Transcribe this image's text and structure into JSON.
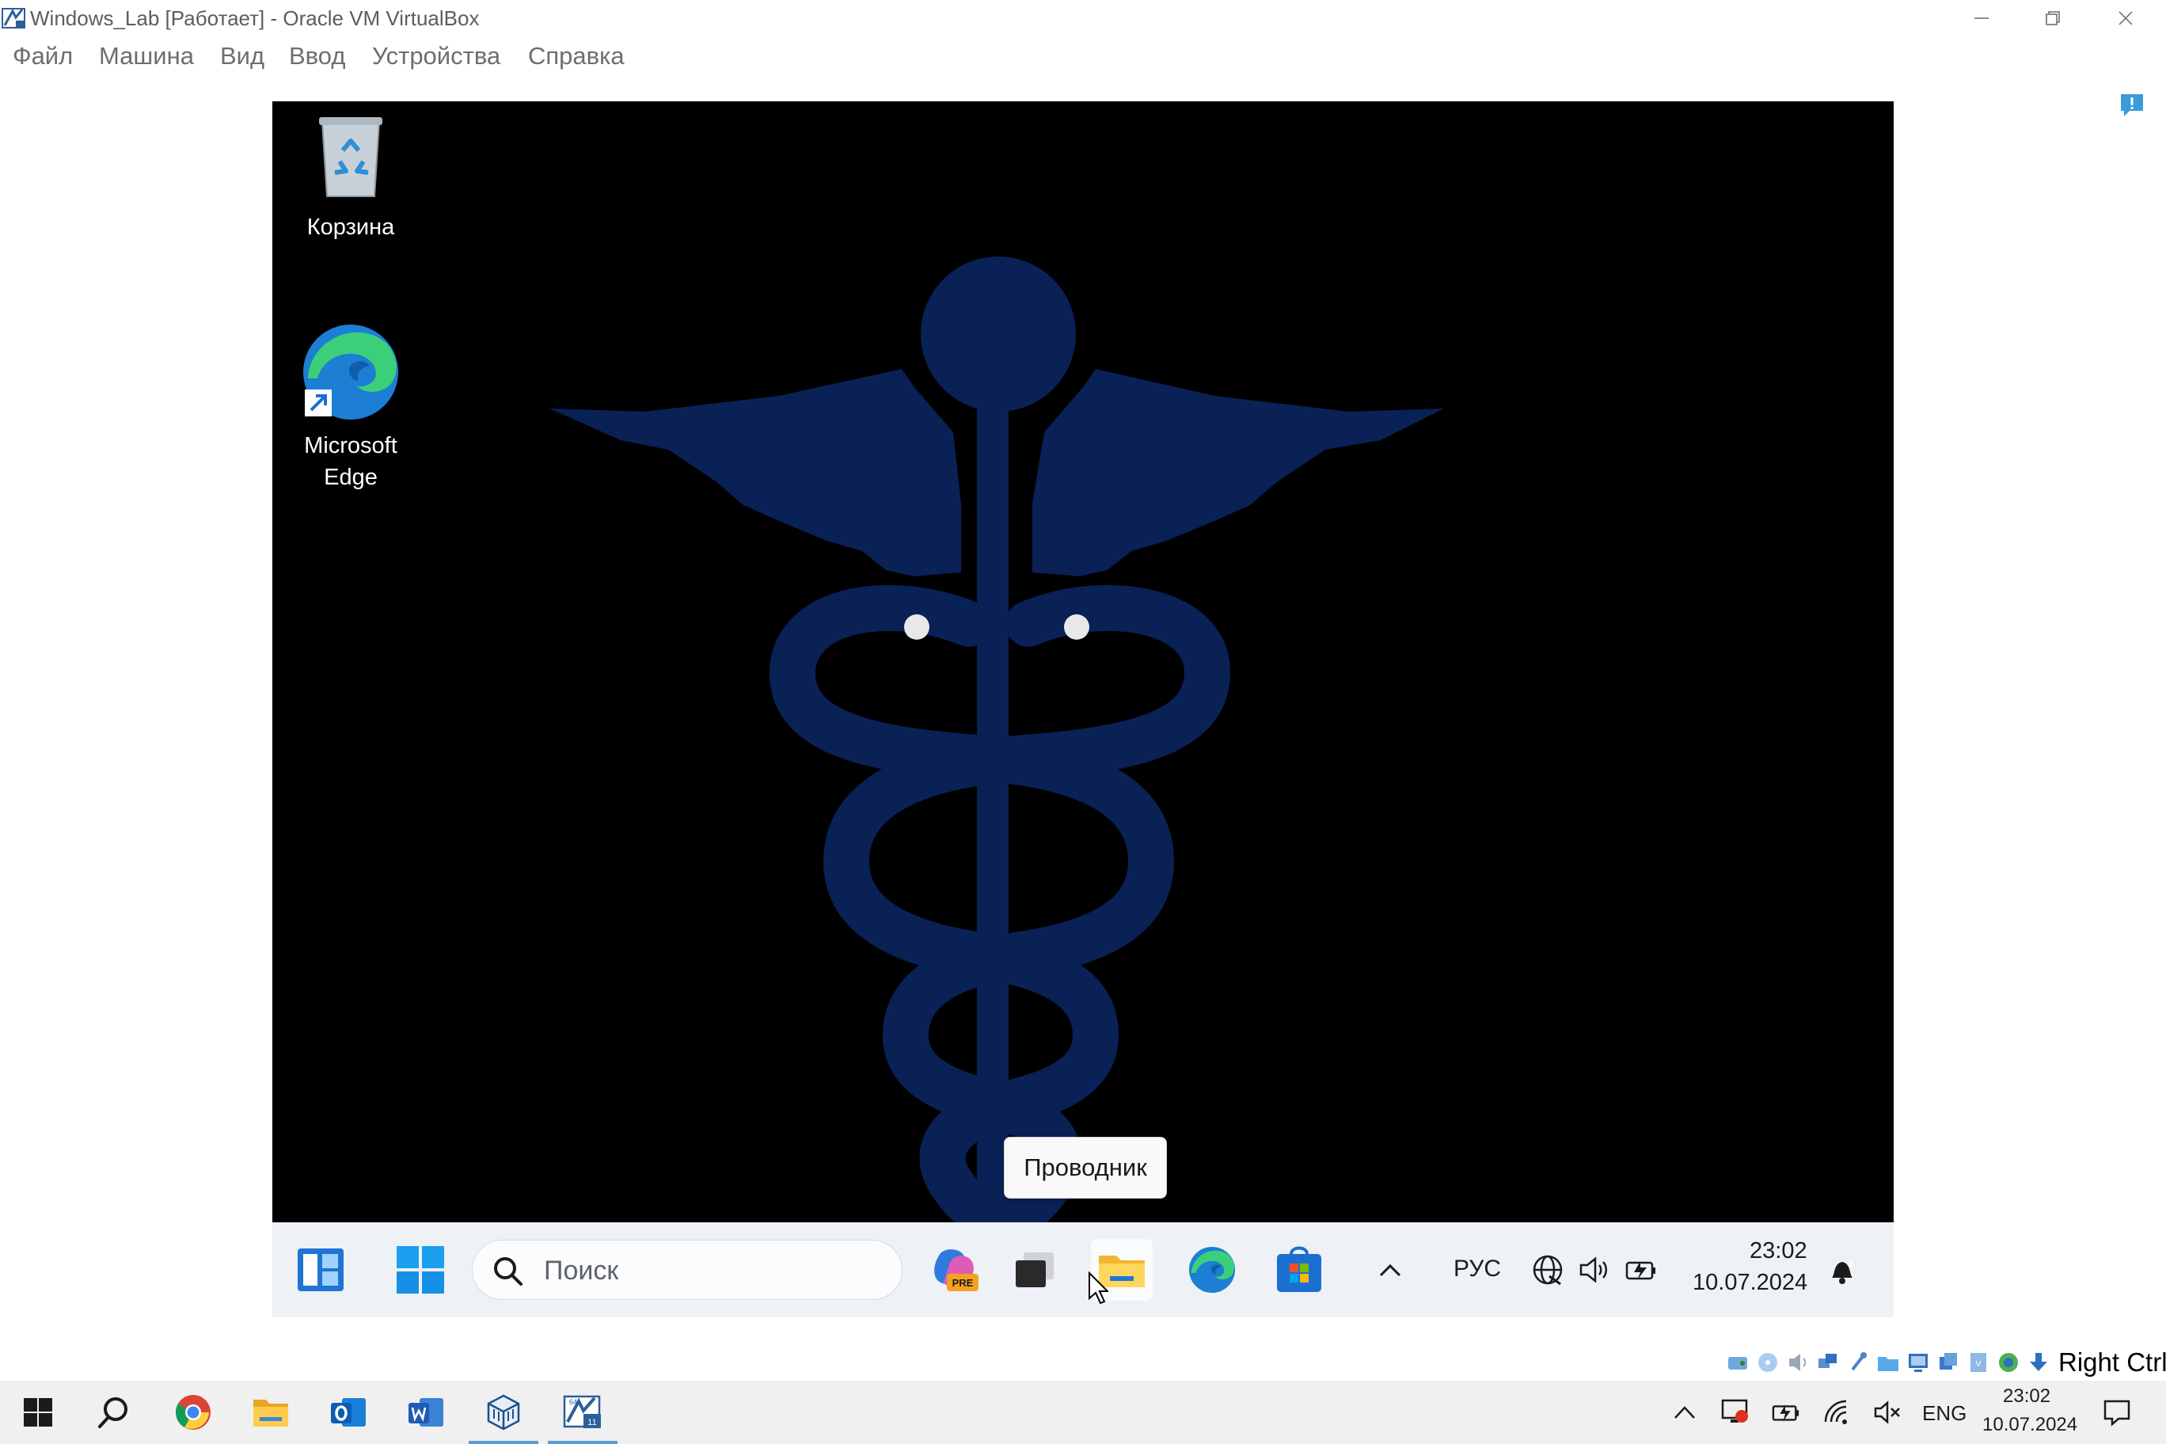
{
  "window": {
    "title": "Windows_Lab [Работает] - Oracle VM VirtualBox"
  },
  "menu": {
    "items": [
      "Файл",
      "Машина",
      "Вид",
      "Ввод",
      "Устройства",
      "Справка"
    ]
  },
  "guest": {
    "desktop_icons": [
      {
        "label": "Корзина",
        "icon": "recycle-bin-icon"
      },
      {
        "label": "Microsoft Edge",
        "icon": "edge-icon"
      }
    ],
    "tooltip": "Проводник",
    "taskbar": {
      "search_placeholder": "Поиск",
      "apps": [
        "widgets-icon",
        "start-icon",
        "copilot-icon",
        "task-view-icon",
        "file-explorer-icon",
        "edge-icon",
        "store-icon"
      ],
      "language": "РУС",
      "time": "23:02",
      "date": "10.07.2024"
    }
  },
  "statusbar": {
    "host_key": "Right Ctrl"
  },
  "host": {
    "taskbar_apps": [
      "windows-start-icon",
      "search-icon",
      "chrome-icon",
      "file-explorer-icon",
      "outlook-icon",
      "word-icon",
      "virtualbox-icon",
      "vm-window-icon"
    ],
    "language": "ENG",
    "time": "23:02",
    "date": "10.07.2024"
  },
  "colors": {
    "caduceus": "#0a2156",
    "host_active_accent": "#5b9bd5",
    "vm_taskbar_bg": "#eef1f5"
  }
}
